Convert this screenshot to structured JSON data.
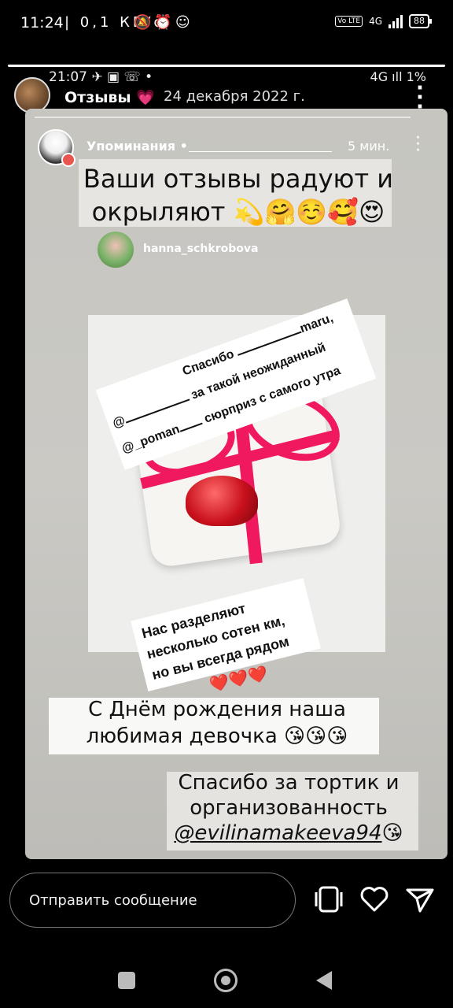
{
  "status_bar": {
    "time": "11:24",
    "network_speed": "| 0,1 КБ/с",
    "network_type": "4G",
    "volte": "Vo LTE",
    "battery": "88"
  },
  "story_header": {
    "inner_time": "21:07",
    "inner_battery": "1%",
    "inner_network": "4G",
    "account_name": "Отзывы",
    "account_emoji": "💗",
    "date": "24 декабря 2022 г."
  },
  "story_content": {
    "mentions_title": "Упоминания •",
    "mentions_time": "5 мин.",
    "banner_text": "Ваши отзывы радуют и окрыляют 💫🤗☺️🥰😍",
    "tagged_user": "hanna_schkrobova",
    "sticker_1": {
      "line1": "Спасибо",
      "line1_tail": "maru,",
      "line2_prefix": "@",
      "line2_tail": "за такой неожиданный",
      "line3_prefix": "@_poman",
      "line3_tail": "сюрприз с самого утра"
    },
    "sticker_2": "Нас разделяют несколько сотен км, но вы всегда рядом",
    "hearts": "❤️❤️❤️",
    "birthday_text": "С Днём рождения наша любимая девочка 😘😘😘",
    "thanks_text": "Спасибо за тортик и организованность",
    "thanks_handle": "@evilinamakeeva94",
    "thanks_emoji": "😘"
  },
  "reply_bar": {
    "placeholder": "Отправить сообщение"
  },
  "icons": [
    "alarm-icon",
    "whatsapp-icon",
    "telegram-icon",
    "heart-icon",
    "send-icon",
    "multi-story-icon"
  ]
}
